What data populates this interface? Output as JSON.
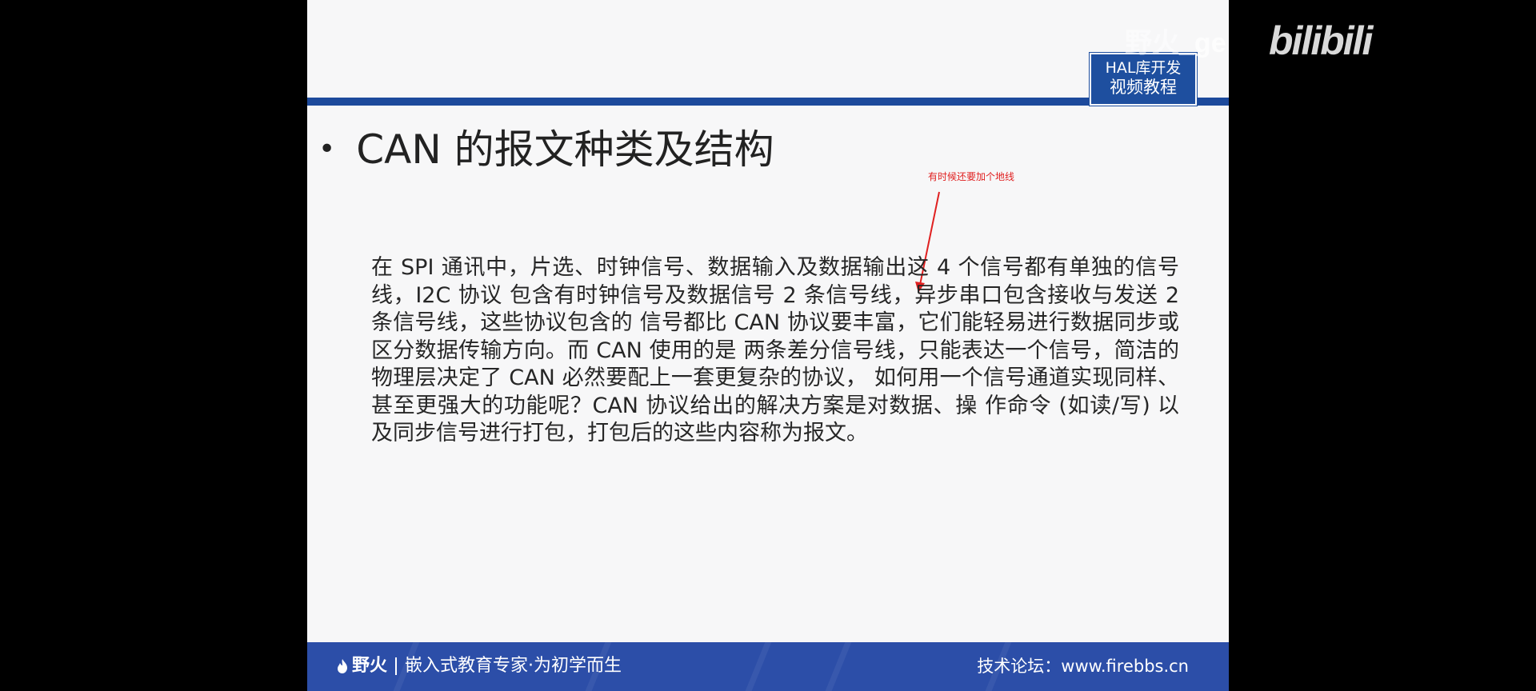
{
  "course_badge": {
    "line1": "HAL库开发",
    "line2": "视频教程"
  },
  "slide": {
    "title": "CAN 的报文种类及结构",
    "annotation": "有时候还要加个地线",
    "body": "在 SPI 通讯中，片选、时钟信号、数据输入及数据输出这 4 个信号都有单独的信号线，I2C 协议 包含有时钟信号及数据信号 2 条信号线，异步串口包含接收与发送 2 条信号线，这些协议包含的 信号都比 CAN 协议要丰富，它们能轻易进行数据同步或区分数据传输方向。而 CAN 使用的是 两条差分信号线，只能表达一个信号，简洁的物理层决定了 CAN 必然要配上一套更复杂的协议， 如何用一个信号通道实现同样、甚至更强大的功能呢？CAN 协议给出的解决方案是对数据、操 作命令 (如读/写) 以及同步信号进行打包，打包后的这些内容称为报文。"
  },
  "footer": {
    "brand": "野火",
    "slogan": "嵌入式教育专家·为初学而生",
    "forum": "技术论坛：www.firebbs.cn"
  },
  "watermark": {
    "faded": "野火_",
    "text": "ge",
    "logo": "bilibili"
  },
  "colors": {
    "brand_blue": "#1d4a9c",
    "footer_blue": "#2c4ea8",
    "annotation_red": "#e02020"
  }
}
